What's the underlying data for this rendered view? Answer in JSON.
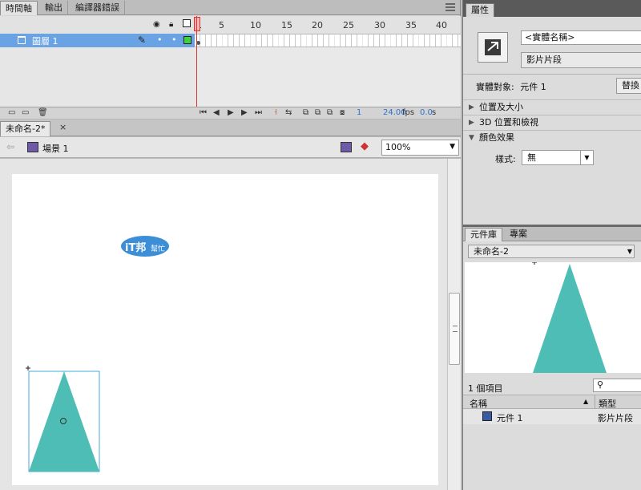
{
  "timeline": {
    "tabs": [
      "時間軸",
      "輸出",
      "編譯器錯誤"
    ],
    "frame_numbers": [
      "1",
      "5",
      "10",
      "15",
      "20",
      "25",
      "30",
      "35",
      "40"
    ],
    "layer": {
      "name": "圖層 1"
    },
    "current_frame": "1",
    "fps": "24.00",
    "fps_unit": "fps",
    "time": "0.0",
    "time_unit": "s"
  },
  "document": {
    "tab_title": "未命名-2*",
    "close_symbol": "×",
    "scene": "場景 1",
    "zoom": "100%"
  },
  "properties": {
    "tab": "屬性",
    "instance_name_placeholder": "<實體名稱>",
    "symbol_type": "影片片段",
    "instance_of_label": "實體對象:",
    "instance_of_value": "元件 1",
    "swap_button": "替換",
    "sections": [
      "位置及大小",
      "3D 位置和檢視",
      "顏色效果"
    ],
    "style_label": "樣式:",
    "style_value": "無"
  },
  "library": {
    "tabs": [
      "元件庫",
      "專案"
    ],
    "document": "未命名-2",
    "item_count": "1 個項目",
    "columns": {
      "name": "名稱",
      "type": "類型"
    },
    "items": [
      {
        "name": "元件 1",
        "type": "影片片段"
      }
    ]
  },
  "watermark": {
    "text1": "iT邦",
    "text2": "幫忙"
  },
  "colors": {
    "shape_fill": "#4dbdb5",
    "selection_blue": "#6aa3e3",
    "playhead_red": "#e03030",
    "link_blue": "#2e6fcf"
  }
}
